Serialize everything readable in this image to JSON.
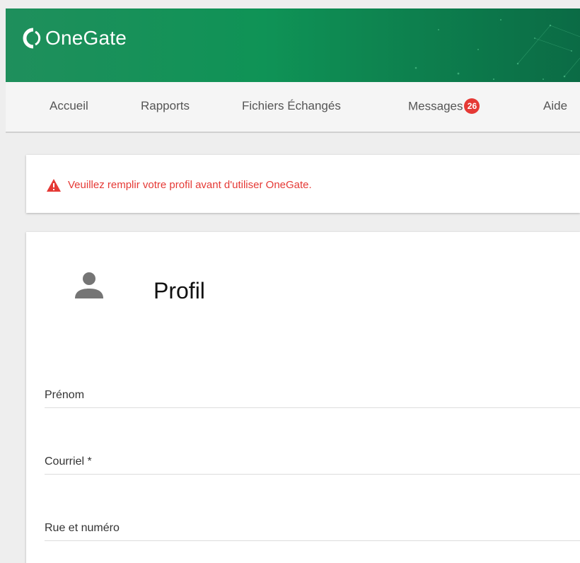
{
  "app": {
    "name": "OneGate",
    "brand_color": "#1f8f5c"
  },
  "nav": {
    "items": [
      {
        "label": "Accueil"
      },
      {
        "label": "Rapports"
      },
      {
        "label": "Fichiers Échangés"
      },
      {
        "label": "Messages",
        "badge": "26"
      },
      {
        "label": "Aide"
      }
    ]
  },
  "alert": {
    "icon": "warning-triangle-icon",
    "text": "Veuillez remplir votre profil avant d'utiliser OneGate.",
    "color": "#e53935"
  },
  "profile": {
    "icon": "person-icon",
    "title": "Profil",
    "fields": [
      {
        "label": "Prénom",
        "value": ""
      },
      {
        "label": "Courriel *",
        "value": ""
      },
      {
        "label": "Rue et numéro",
        "value": ""
      }
    ]
  }
}
